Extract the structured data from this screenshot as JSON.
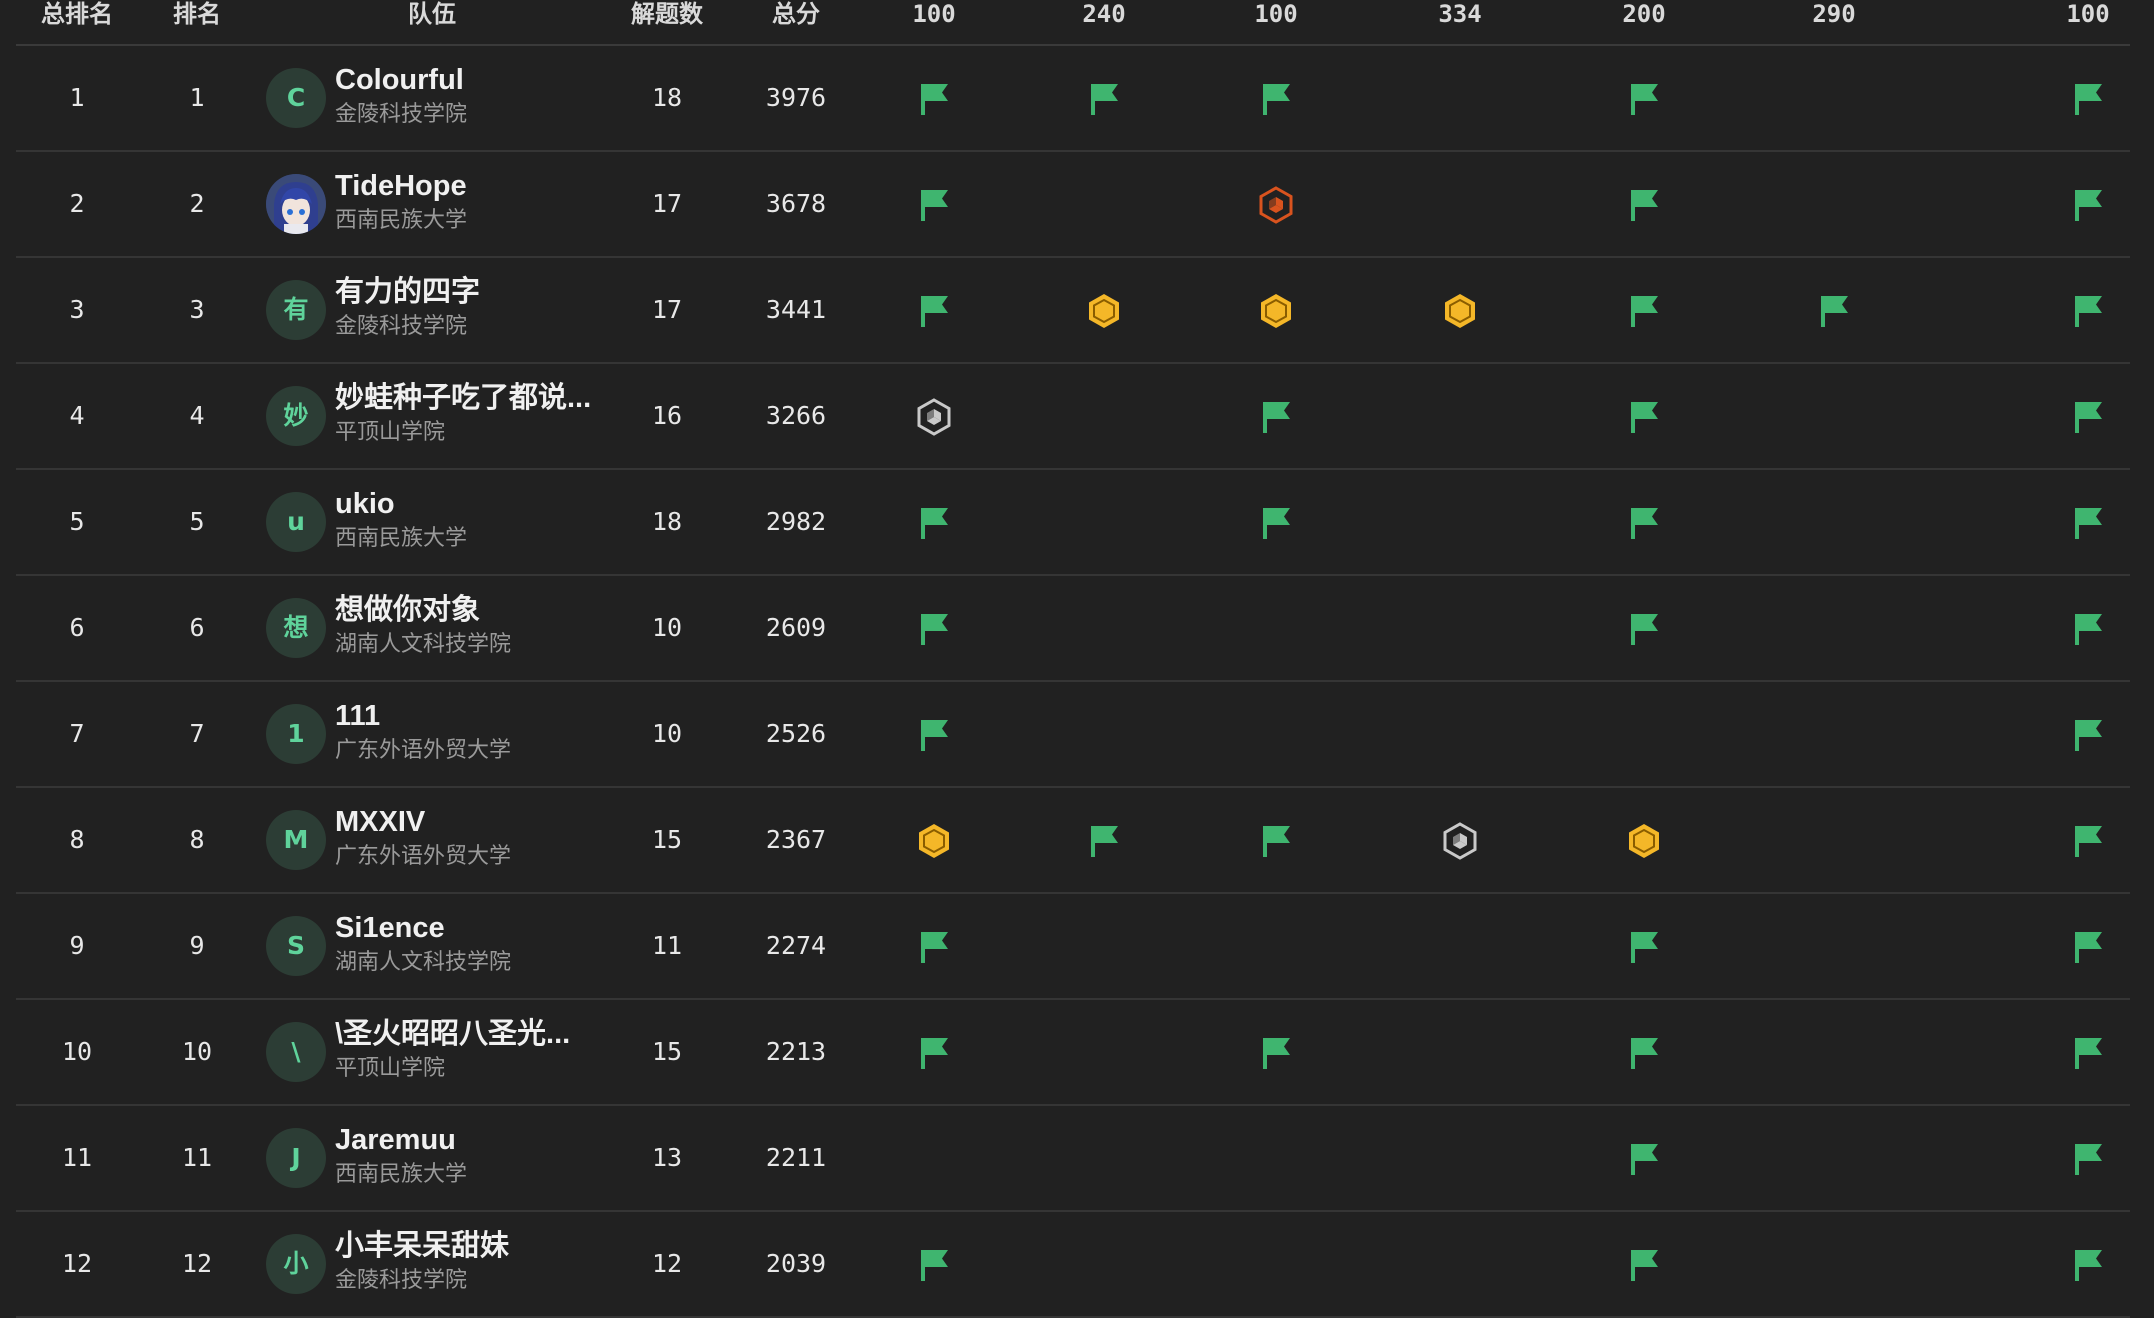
{
  "colors": {
    "background": "#212121",
    "flag": "#3fb56f",
    "gold": "#f4b728",
    "silver": "#c9c9c9",
    "bronze": "#d9531e",
    "avatar_bg": "#2c3d35",
    "avatar_fg": "#5fd39b"
  },
  "header": {
    "overall_rank": "总排名",
    "rank": "排名",
    "team": "队伍",
    "solved": "解题数",
    "score": "总分",
    "problems": [
      "100",
      "240",
      "100",
      "334",
      "200",
      "290",
      "100"
    ]
  },
  "rows": [
    {
      "overall": "1",
      "rank": "1",
      "avatar": "C",
      "avatar_image": false,
      "name": "Colourful",
      "school": "金陵科技学院",
      "solved": "18",
      "score": "3976",
      "marks": [
        "flag",
        "flag",
        "flag",
        "",
        "flag",
        "",
        "flag"
      ]
    },
    {
      "overall": "2",
      "rank": "2",
      "avatar": "",
      "avatar_image": true,
      "name": "TideHope",
      "school": "西南民族大学",
      "solved": "17",
      "score": "3678",
      "marks": [
        "flag",
        "",
        "bronze",
        "",
        "flag",
        "",
        "flag"
      ]
    },
    {
      "overall": "3",
      "rank": "3",
      "avatar": "有",
      "avatar_image": false,
      "name": "有力的四字",
      "school": "金陵科技学院",
      "solved": "17",
      "score": "3441",
      "marks": [
        "flag",
        "gold",
        "gold",
        "gold",
        "flag",
        "flag",
        "flag"
      ]
    },
    {
      "overall": "4",
      "rank": "4",
      "avatar": "妙",
      "avatar_image": false,
      "name": "妙蛙种子吃了都说...",
      "school": "平顶山学院",
      "solved": "16",
      "score": "3266",
      "marks": [
        "silver",
        "",
        "flag",
        "",
        "flag",
        "",
        "flag"
      ]
    },
    {
      "overall": "5",
      "rank": "5",
      "avatar": "u",
      "avatar_image": false,
      "name": "ukio",
      "school": "西南民族大学",
      "solved": "18",
      "score": "2982",
      "marks": [
        "flag",
        "",
        "flag",
        "",
        "flag",
        "",
        "flag"
      ]
    },
    {
      "overall": "6",
      "rank": "6",
      "avatar": "想",
      "avatar_image": false,
      "name": "想做你对象",
      "school": "湖南人文科技学院",
      "solved": "10",
      "score": "2609",
      "marks": [
        "flag",
        "",
        "",
        "",
        "flag",
        "",
        "flag"
      ]
    },
    {
      "overall": "7",
      "rank": "7",
      "avatar": "1",
      "avatar_image": false,
      "name": "111",
      "school": "广东外语外贸大学",
      "solved": "10",
      "score": "2526",
      "marks": [
        "flag",
        "",
        "",
        "",
        "",
        "",
        "flag"
      ]
    },
    {
      "overall": "8",
      "rank": "8",
      "avatar": "M",
      "avatar_image": false,
      "name": "MXXIV",
      "school": "广东外语外贸大学",
      "solved": "15",
      "score": "2367",
      "marks": [
        "gold",
        "flag",
        "flag",
        "silver",
        "gold",
        "",
        "flag"
      ]
    },
    {
      "overall": "9",
      "rank": "9",
      "avatar": "S",
      "avatar_image": false,
      "name": "Si1ence",
      "school": "湖南人文科技学院",
      "solved": "11",
      "score": "2274",
      "marks": [
        "flag",
        "",
        "",
        "",
        "flag",
        "",
        "flag"
      ]
    },
    {
      "overall": "10",
      "rank": "10",
      "avatar": "\\",
      "avatar_image": false,
      "name": "\\圣火昭昭八圣光...",
      "school": "平顶山学院",
      "solved": "15",
      "score": "2213",
      "marks": [
        "flag",
        "",
        "flag",
        "",
        "flag",
        "",
        "flag"
      ]
    },
    {
      "overall": "11",
      "rank": "11",
      "avatar": "J",
      "avatar_image": false,
      "name": "Jaremuu",
      "school": "西南民族大学",
      "solved": "13",
      "score": "2211",
      "marks": [
        "",
        "",
        "",
        "",
        "flag",
        "",
        "flag"
      ]
    },
    {
      "overall": "12",
      "rank": "12",
      "avatar": "小",
      "avatar_image": false,
      "name": "小丰呆呆甜妹",
      "school": "金陵科技学院",
      "solved": "12",
      "score": "2039",
      "marks": [
        "flag",
        "",
        "",
        "",
        "flag",
        "",
        "flag"
      ]
    }
  ]
}
